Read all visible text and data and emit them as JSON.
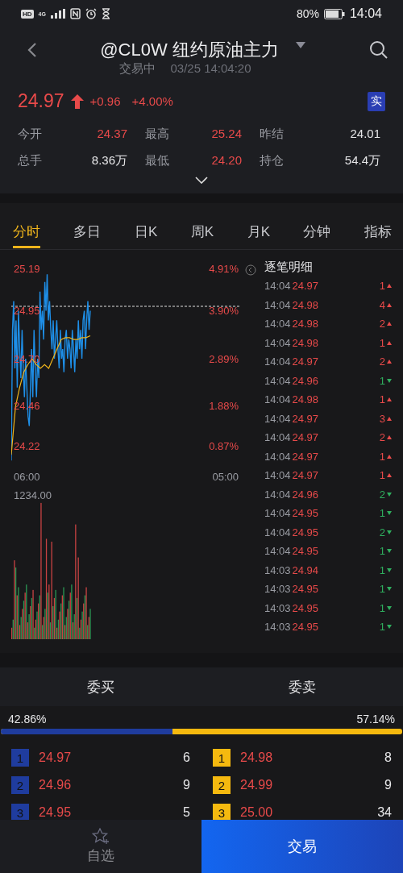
{
  "status_bar": {
    "badges": [
      "HD",
      "4G"
    ],
    "battery": "80%",
    "time": "14:04"
  },
  "header": {
    "title": "@CL0W 纽约原油主力",
    "status": "交易中",
    "datetime": "03/25 14:04:20"
  },
  "quote": {
    "price": "24.97",
    "up": true,
    "change": "+0.96",
    "change_pct": "+4.00%",
    "badge": "实"
  },
  "stats": [
    {
      "label": "今开",
      "value": "24.37",
      "kind": "up"
    },
    {
      "label": "最高",
      "value": "25.24",
      "kind": "up"
    },
    {
      "label": "昨结",
      "value": "24.01",
      "kind": "neutral"
    },
    {
      "label": "总手",
      "value": "8.36万",
      "kind": "neutral"
    },
    {
      "label": "最低",
      "value": "24.20",
      "kind": "up"
    },
    {
      "label": "持仓",
      "value": "54.4万",
      "kind": "neutral"
    }
  ],
  "tabs": [
    {
      "label": "分时",
      "selected": true
    },
    {
      "label": "多日",
      "selected": false
    },
    {
      "label": "日K",
      "selected": false
    },
    {
      "label": "周K",
      "selected": false
    },
    {
      "label": "月K",
      "selected": false
    },
    {
      "label": "分钟",
      "selected": false
    },
    {
      "label": "指标",
      "selected": false
    }
  ],
  "price_chart": {
    "price_labels": [
      "25.19",
      "24.95",
      "24.70",
      "24.46",
      "24.22"
    ],
    "pct_labels": [
      "4.91%",
      "3.90%",
      "2.89%",
      "1.88%",
      "0.87%"
    ],
    "time_labels": [
      "06:00",
      "05:00"
    ]
  },
  "volume_chart": {
    "max_label": "1234.00"
  },
  "tape": {
    "title": "逐笔明细",
    "rows": [
      {
        "time": "14:04",
        "price": "24.97",
        "volume": "1",
        "up": true
      },
      {
        "time": "14:04",
        "price": "24.98",
        "volume": "4",
        "up": true
      },
      {
        "time": "14:04",
        "price": "24.98",
        "volume": "2",
        "up": true
      },
      {
        "time": "14:04",
        "price": "24.98",
        "volume": "1",
        "up": true
      },
      {
        "time": "14:04",
        "price": "24.97",
        "volume": "2",
        "up": true
      },
      {
        "time": "14:04",
        "price": "24.96",
        "volume": "1",
        "up": false
      },
      {
        "time": "14:04",
        "price": "24.98",
        "volume": "1",
        "up": true
      },
      {
        "time": "14:04",
        "price": "24.97",
        "volume": "3",
        "up": true
      },
      {
        "time": "14:04",
        "price": "24.97",
        "volume": "2",
        "up": true
      },
      {
        "time": "14:04",
        "price": "24.97",
        "volume": "1",
        "up": true
      },
      {
        "time": "14:04",
        "price": "24.97",
        "volume": "1",
        "up": true
      },
      {
        "time": "14:04",
        "price": "24.96",
        "volume": "2",
        "up": false
      },
      {
        "time": "14:04",
        "price": "24.95",
        "volume": "1",
        "up": false
      },
      {
        "time": "14:04",
        "price": "24.95",
        "volume": "2",
        "up": false
      },
      {
        "time": "14:04",
        "price": "24.95",
        "volume": "1",
        "up": false
      },
      {
        "time": "14:03",
        "price": "24.94",
        "volume": "1",
        "up": false
      },
      {
        "time": "14:03",
        "price": "24.95",
        "volume": "1",
        "up": false
      },
      {
        "time": "14:03",
        "price": "24.95",
        "volume": "1",
        "up": false
      },
      {
        "time": "14:03",
        "price": "24.95",
        "volume": "1",
        "up": false
      }
    ]
  },
  "order_book": {
    "bid_title": "委买",
    "ask_title": "委卖",
    "bid_pct": "42.86%",
    "ask_pct": "57.14%",
    "ratio": {
      "level": 0.4286
    },
    "bids": [
      {
        "rank": "1",
        "price": "24.97",
        "qty": "6"
      },
      {
        "rank": "2",
        "price": "24.96",
        "qty": "9"
      },
      {
        "rank": "3",
        "price": "24.95",
        "qty": "5"
      }
    ],
    "asks": [
      {
        "rank": "1",
        "price": "24.98",
        "qty": "8"
      },
      {
        "rank": "2",
        "price": "24.99",
        "qty": "9"
      },
      {
        "rank": "3",
        "price": "25.00",
        "qty": "34"
      }
    ]
  },
  "bottom_bar": {
    "watchlist": "自选",
    "trade": "交易"
  }
}
